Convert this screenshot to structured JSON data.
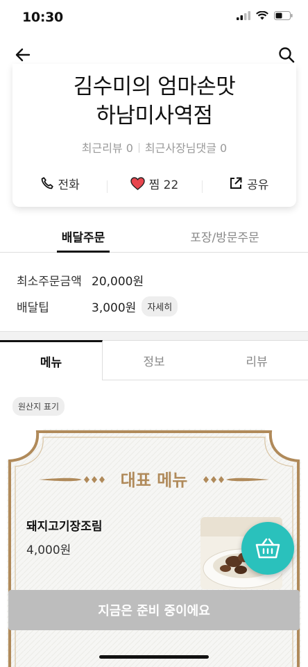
{
  "status_bar": {
    "time": "10:30"
  },
  "store": {
    "name_line1": "김수미의 엄마손맛",
    "name_line2": "하남미사역점",
    "recent_reviews": "최근리뷰 0",
    "owner_replies": "최근사장님댓글 0"
  },
  "actions": {
    "call": "전화",
    "like": "찜 22",
    "share": "공유"
  },
  "order_tabs": {
    "delivery": "배달주문",
    "pickup": "포장/방문주문"
  },
  "order_info": {
    "min_order_label": "최소주문금액",
    "min_order_value": "20,000원",
    "delivery_tip_label": "배달팁",
    "delivery_tip_value": "3,000원",
    "detail_chip": "자세히"
  },
  "content_tabs": {
    "menu": "메뉴",
    "info": "정보",
    "review": "리뷰"
  },
  "origin_chip": "원산지 표기",
  "signature_section": {
    "title": "대표 메뉴"
  },
  "menu_item": {
    "name": "돼지고기장조림",
    "price": "4,000원"
  },
  "cta": "지금은 준비 중이에요",
  "colors": {
    "accent": "#2ac1bc",
    "gold": "#b08a5a",
    "heart": "#e8464e",
    "cta_bg": "#bdbdbd"
  },
  "icons": [
    "back-arrow-icon",
    "search-icon",
    "phone-icon",
    "heart-icon",
    "share-icon",
    "cart-icon"
  ]
}
